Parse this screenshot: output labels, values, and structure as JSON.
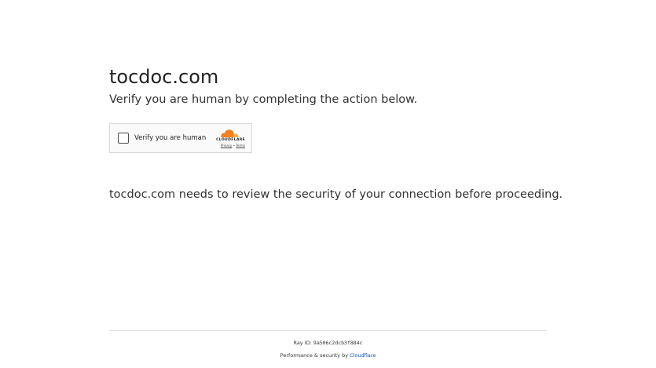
{
  "site": {
    "title": "tocdoc.com",
    "subtitle": "Verify you are human by completing the action below."
  },
  "challenge": {
    "checkbox_label": "Verify you are human",
    "brand": "CLOUDFLARE",
    "privacy_link": "Privacy",
    "separator": "•",
    "terms_link": "Terms"
  },
  "message": "tocdoc.com needs to review the security of your connection before proceeding.",
  "footer": {
    "ray_label": "Ray ID:",
    "ray_id": "9a506c2dcb3f884c",
    "performance_text": "Performance & security by",
    "performance_link": "Cloudflare"
  },
  "colors": {
    "link": "#0051c3",
    "cloud_orange": "#f38020",
    "cloud_light_orange": "#faae40"
  }
}
